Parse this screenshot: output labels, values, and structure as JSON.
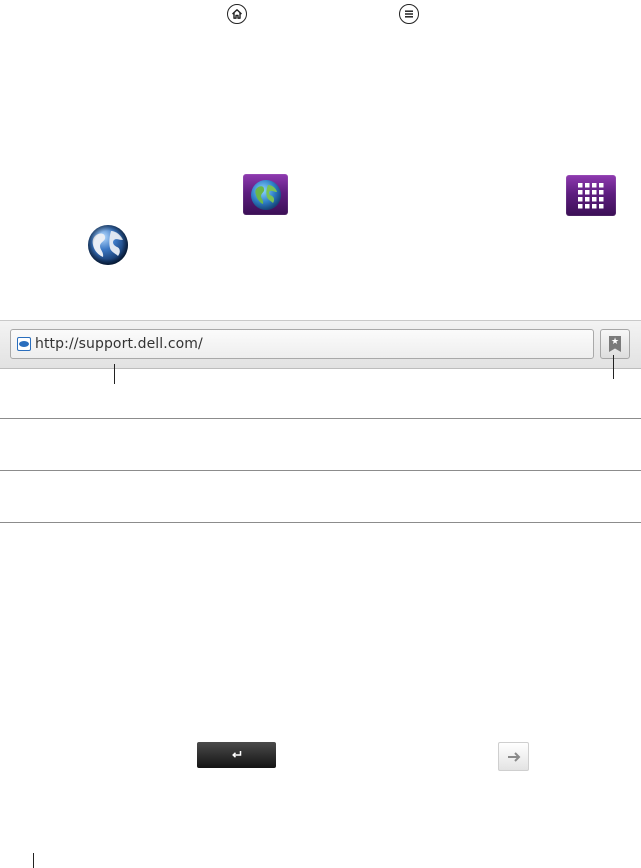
{
  "top_icons": {
    "home_icon": "home-icon",
    "menu_icon": "menu-icon"
  },
  "app_tiles": {
    "browser_tile_icon": "globe-icon",
    "apps_tile_icon": "app-grid-icon"
  },
  "browser_icon": "globe-icon",
  "browser": {
    "url": "http://support.dell.com/",
    "favicon": "dell-favicon-icon",
    "bookmark_icon": "bookmark-star-icon"
  },
  "keyboard": {
    "enter_icon": "enter-icon",
    "go_icon": "arrow-right-icon"
  },
  "colors": {
    "tile_purple": "#5e1e80",
    "enter_key_bg": "#141414"
  }
}
